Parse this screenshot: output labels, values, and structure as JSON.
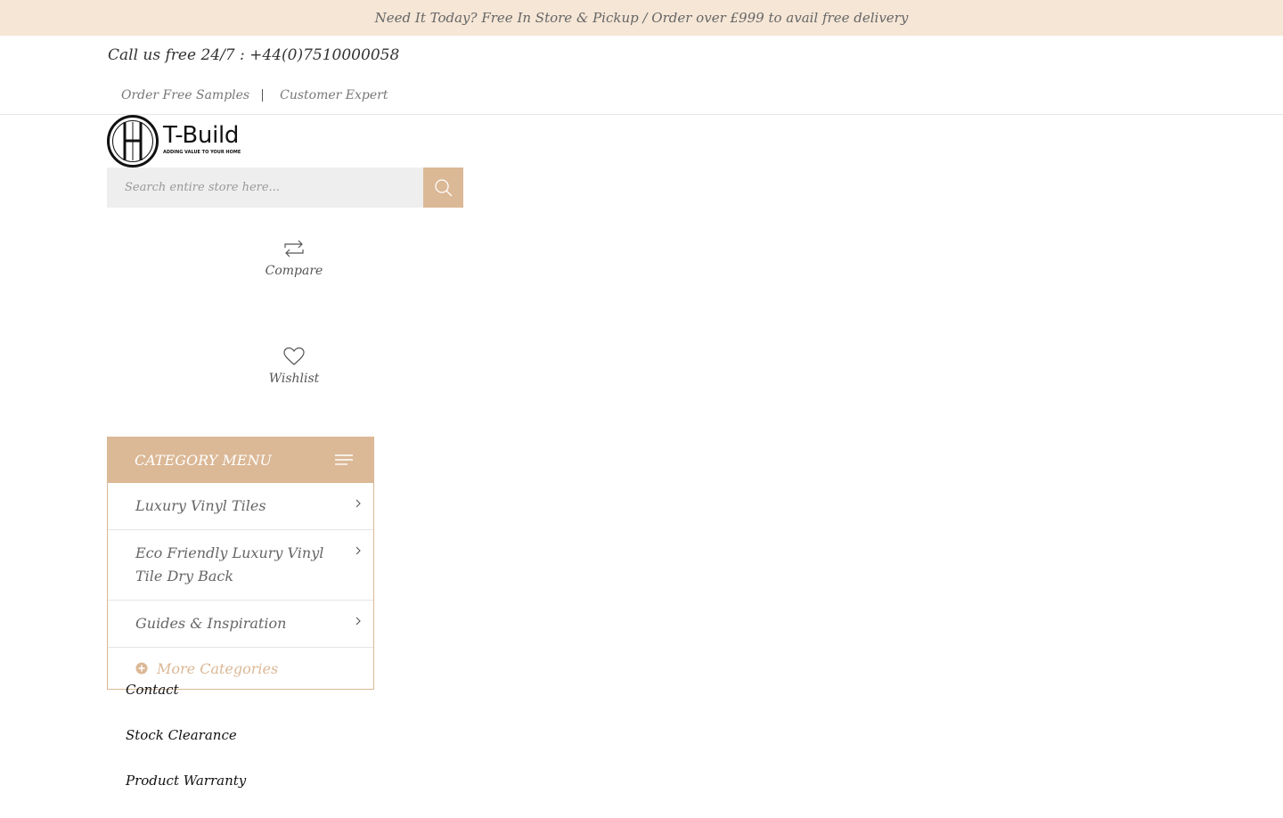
{
  "topbar": {
    "text": "Need It Today? Free In Store & Pickup / Order over £999 to avail free delivery"
  },
  "header": {
    "call_text": "Call us free 24/7 : +44(0)7510000058",
    "links": [
      "Order Free Samples",
      "Customer Expert"
    ]
  },
  "logo": {
    "name": "T-Build",
    "tagline": "ADDING VALUE TO YOUR HOME"
  },
  "search": {
    "placeholder": "Search entire store here..."
  },
  "actions": {
    "compare": "Compare",
    "wishlist": "Wishlist"
  },
  "category_menu": {
    "title": "CATEGORY MENU",
    "items": [
      "Luxury Vinyl Tiles",
      "Eco Friendly Luxury Vinyl Tile Dry Back",
      "Guides & Inspiration"
    ],
    "more_label": "More Categories"
  },
  "nav_links": [
    "Contact",
    "Stock Clearance",
    "Product Warranty"
  ],
  "colors": {
    "accent": "#dbb896",
    "topbar_bg": "#f5e6d6"
  }
}
